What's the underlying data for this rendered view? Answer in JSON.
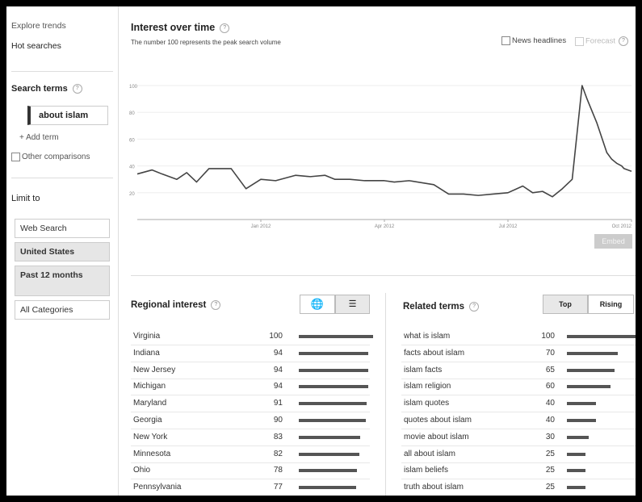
{
  "sidebar": {
    "explore_trends": "Explore trends",
    "hot_searches": "Hot searches",
    "search_terms_label": "Search terms",
    "term": "about islam",
    "add_term": "+ Add term",
    "other_comparisons": "Other comparisons",
    "limit_to": "Limit to",
    "filters": [
      {
        "label": "Web Search",
        "selected": false
      },
      {
        "label": "United States",
        "selected": true
      },
      {
        "label": "Past 12 months",
        "selected": true
      },
      {
        "label": "All Categories",
        "selected": false
      }
    ]
  },
  "interest": {
    "title": "Interest over time",
    "subtitle": "The number 100 represents the peak search volume",
    "news_headlines": "News headlines",
    "forecast": "Forecast",
    "embed": "Embed"
  },
  "chart_data": {
    "type": "line",
    "yticks": [
      100,
      80,
      60,
      40,
      20
    ],
    "ylim": [
      0,
      100
    ],
    "xticks": [
      {
        "label": "Jan 2012",
        "x": 0.25
      },
      {
        "label": "Apr 2012",
        "x": 0.5
      },
      {
        "label": "Jul 2012",
        "x": 0.75
      },
      {
        "label": "Oct 2012",
        "x": 1.0
      }
    ],
    "x": [
      0.0,
      0.03,
      0.05,
      0.08,
      0.1,
      0.12,
      0.145,
      0.17,
      0.19,
      0.22,
      0.25,
      0.28,
      0.32,
      0.35,
      0.38,
      0.4,
      0.43,
      0.46,
      0.5,
      0.52,
      0.55,
      0.6,
      0.63,
      0.66,
      0.69,
      0.72,
      0.75,
      0.78,
      0.8,
      0.82,
      0.84,
      0.86,
      0.88,
      0.9,
      0.91,
      0.93,
      0.95,
      0.96,
      0.97,
      0.98,
      0.985,
      1.0
    ],
    "y": [
      34,
      37,
      34,
      30,
      35,
      28,
      38,
      38,
      38,
      23,
      30,
      29,
      33,
      32,
      33,
      30,
      30,
      29,
      29,
      28,
      29,
      26,
      19,
      19,
      18,
      19,
      20,
      25,
      20,
      21,
      17,
      23,
      30,
      100,
      90,
      72,
      50,
      45,
      42,
      40,
      38,
      36
    ],
    "grid": true
  },
  "regional": {
    "title": "Regional interest",
    "rows": [
      {
        "name": "Virginia",
        "value": 100
      },
      {
        "name": "Indiana",
        "value": 94
      },
      {
        "name": "New Jersey",
        "value": 94
      },
      {
        "name": "Michigan",
        "value": 94
      },
      {
        "name": "Maryland",
        "value": 91
      },
      {
        "name": "Georgia",
        "value": 90
      },
      {
        "name": "New York",
        "value": 83
      },
      {
        "name": "Minnesota",
        "value": 82
      },
      {
        "name": "Ohio",
        "value": 78
      },
      {
        "name": "Pennsylvania",
        "value": 77
      }
    ]
  },
  "related": {
    "title": "Related terms",
    "top": "Top",
    "rising": "Rising",
    "rows": [
      {
        "name": "what is islam",
        "value": 100
      },
      {
        "name": "facts about islam",
        "value": 70
      },
      {
        "name": "islam facts",
        "value": 65
      },
      {
        "name": "islam religion",
        "value": 60
      },
      {
        "name": "islam quotes",
        "value": 40
      },
      {
        "name": "quotes about islam",
        "value": 40
      },
      {
        "name": "movie about islam",
        "value": 30
      },
      {
        "name": "all about islam",
        "value": 25
      },
      {
        "name": "islam beliefs",
        "value": 25
      },
      {
        "name": "truth about islam",
        "value": 25
      }
    ]
  }
}
